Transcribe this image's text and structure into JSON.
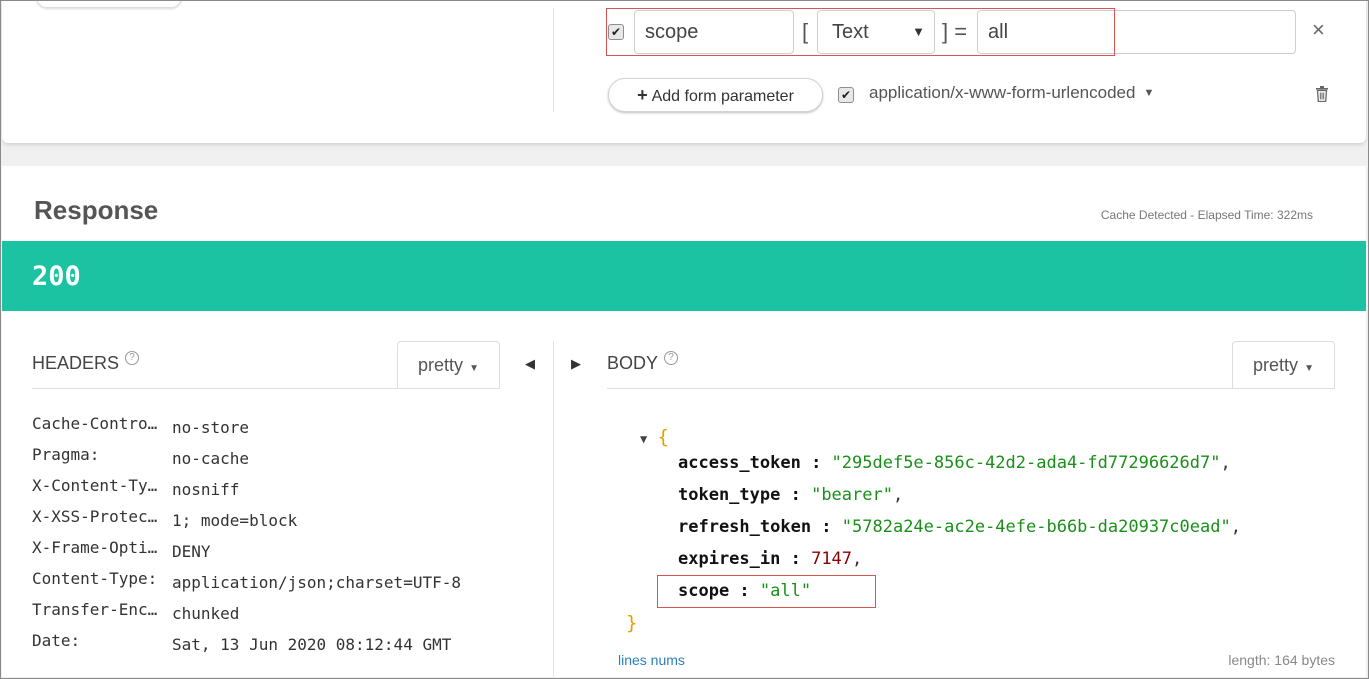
{
  "request": {
    "param_name": "scope",
    "param_type": "Text",
    "param_type_caret": "▼",
    "bracket_open": "[",
    "bracket_close_eq": "] =",
    "param_value": "all",
    "remove_symbol": "×",
    "add_param_label": "Add form parameter",
    "content_type": "application/x-www-form-urlencoded",
    "check_mark": "✔"
  },
  "response": {
    "title": "Response",
    "elapsed": "Cache Detected - Elapsed Time: 322ms",
    "status_code": "200",
    "headers_label": "HEADERS",
    "body_label": "BODY",
    "pretty_label": "pretty",
    "help_symbol": "?",
    "headers": [
      {
        "key": "Cache-Contro…",
        "value": "no-store"
      },
      {
        "key": "Pragma:",
        "value": "no-cache"
      },
      {
        "key": "X-Content-Ty…",
        "value": "nosniff"
      },
      {
        "key": "X-XSS-Protec…",
        "value": "1; mode=block"
      },
      {
        "key": "X-Frame-Opti…",
        "value": "DENY"
      },
      {
        "key": "Content-Type:",
        "value": "application/json;charset=UTF-8"
      },
      {
        "key": "Transfer-Enc…",
        "value": "chunked"
      },
      {
        "key": "Date:",
        "value": "Sat, 13 Jun 2020 08:12:44 GMT"
      }
    ],
    "body": {
      "open_brace": "{",
      "close_brace": "}",
      "fields": [
        {
          "key": "access_token",
          "value": "\"295def5e-856c-42d2-ada4-fd77296626d7\"",
          "type": "string",
          "comma": ","
        },
        {
          "key": "token_type",
          "value": "\"bearer\"",
          "type": "string",
          "comma": ","
        },
        {
          "key": "refresh_token",
          "value": "\"5782a24e-ac2e-4efe-b66b-da20937c0ead\"",
          "type": "string",
          "comma": ","
        },
        {
          "key": "expires_in",
          "value": "7147",
          "type": "number",
          "comma": ","
        },
        {
          "key": "scope",
          "value": "\"all\"",
          "type": "string",
          "comma": ""
        }
      ]
    },
    "lines_nums_label": "lines nums",
    "length_label": "length: 164 bytes"
  },
  "colors": {
    "status_bar": "#1cc3a2",
    "json_string": "#1a8f1a",
    "json_number": "#8b0000",
    "highlight_box": "#d9534f"
  }
}
